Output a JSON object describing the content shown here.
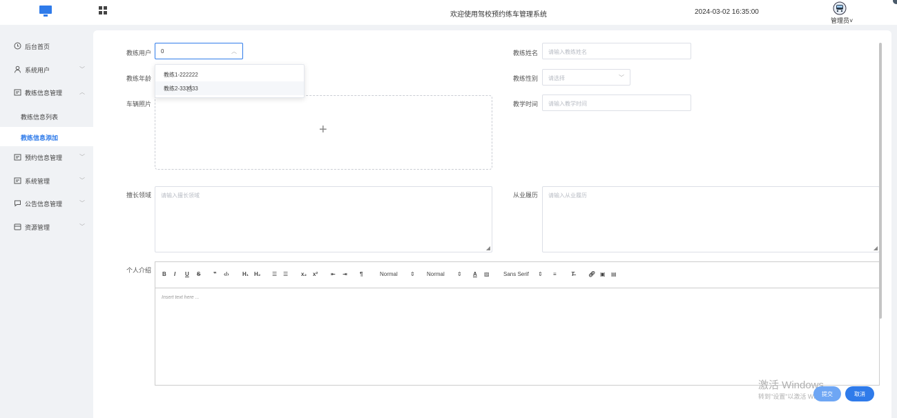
{
  "header": {
    "system_title": "欢迎使用驾校预约练车管理系统",
    "datetime": "2024-03-02 16:35:00",
    "user_label": "管理员˅"
  },
  "sidebar": {
    "items": [
      {
        "label": "后台首页",
        "icon": "clock-icon"
      },
      {
        "label": "系统用户",
        "icon": "user-icon"
      },
      {
        "label": "教练信息管理",
        "icon": "folder-icon"
      },
      {
        "label": "教练信息列表"
      },
      {
        "label": "教练信息添加"
      },
      {
        "label": "预约信息管理",
        "icon": "folder-icon"
      },
      {
        "label": "系统管理",
        "icon": "folder-icon"
      },
      {
        "label": "公告信息管理",
        "icon": "chat-icon"
      },
      {
        "label": "资源管理",
        "icon": "box-icon"
      }
    ]
  },
  "form": {
    "coach_user_label": "教练用户",
    "coach_user_value": "0",
    "coach_name_label": "教练姓名",
    "coach_name_placeholder": "请输入教练姓名",
    "coach_age_label": "教练年龄",
    "coach_gender_label": "教练性别",
    "coach_gender_placeholder": "请选择",
    "car_photo_label": "车辆照片",
    "teach_time_label": "教学时间",
    "teach_time_placeholder": "请输入教学时间",
    "specialty_label": "擅长领域",
    "specialty_placeholder": "请输入擅长领域",
    "experience_label": "从业履历",
    "experience_placeholder": "请输入从业履历",
    "intro_label": "个人介绍",
    "editor_placeholder": "Insert text here ..."
  },
  "dropdown": {
    "options": [
      "教练1-222222",
      "教练2-333333"
    ]
  },
  "toolbar": {
    "bold": "B",
    "italic": "I",
    "underline": "U",
    "strike": "S",
    "quote": "❞",
    "code": "‹/›",
    "h1": "H₁",
    "h2": "H₂",
    "ol": "☰",
    "ul": "☰",
    "sub": "x₂",
    "sup": "x²",
    "outdent": "⇤",
    "indent": "⇥",
    "rtl": "¶",
    "size_select": "Normal",
    "header_select": "Normal",
    "font_select": "Sans Serif"
  },
  "buttons": {
    "submit": "提交",
    "cancel": "取消"
  },
  "watermark": {
    "title": "激活 Windows",
    "subtitle": "转到\"设置\"以激活 Windows。"
  },
  "colors": {
    "accent": "#2f7bea"
  }
}
